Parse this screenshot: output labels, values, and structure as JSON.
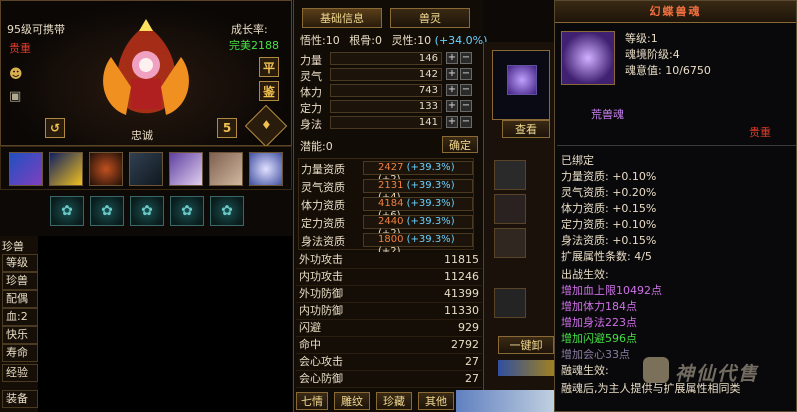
{
  "pet": {
    "level_text": "95级可携带",
    "rarity": "贵重",
    "growth_label": "成长率:",
    "growth_value": "完美2188",
    "name": "忠诚",
    "btn_flat": "平",
    "btn_appraise": "鉴",
    "btn_5": "5"
  },
  "collection": {
    "header": "珍兽",
    "rows": [
      "等级",
      "珍兽",
      "配偶",
      "血:2",
      "快乐",
      "寿命",
      "经验",
      "装备"
    ]
  },
  "tabs": {
    "basic": "基础信息",
    "spirit": "兽灵"
  },
  "stats": {
    "wuxing_label": "悟性:",
    "wuxing_value": "10",
    "gengu_label": "根骨:",
    "gengu_value": "0",
    "lingxing_label": "灵性:",
    "lingxing_value": "10",
    "lingxing_bonus": "(+34.0%)",
    "attrs": [
      {
        "label": "力量",
        "value": "146"
      },
      {
        "label": "灵气",
        "value": "142"
      },
      {
        "label": "体力",
        "value": "743"
      },
      {
        "label": "定力",
        "value": "133"
      },
      {
        "label": "身法",
        "value": "141"
      }
    ],
    "potential_label": "潜能:",
    "potential_value": "0",
    "confirm": "确定",
    "aptitudes": [
      {
        "label": "力量资质",
        "value": "2427",
        "pct": "(+39.3%)",
        "plus": "(+2)"
      },
      {
        "label": "灵气资质",
        "value": "2131",
        "pct": "(+39.3%)",
        "plus": "(+4)"
      },
      {
        "label": "体力资质",
        "value": "4184",
        "pct": "(+39.3%)",
        "plus": "(+6)"
      },
      {
        "label": "定力资质",
        "value": "2440",
        "pct": "(+39.3%)",
        "plus": "(+2)"
      },
      {
        "label": "身法资质",
        "value": "1800",
        "pct": "(+39.3%)",
        "plus": "(+2)"
      }
    ],
    "combat": [
      {
        "label": "外功攻击",
        "value": "11815"
      },
      {
        "label": "内功攻击",
        "value": "11246"
      },
      {
        "label": "外功防御",
        "value": "41399"
      },
      {
        "label": "内功防御",
        "value": "11330"
      },
      {
        "label": "闪避",
        "value": "929"
      },
      {
        "label": "命中",
        "value": "2792"
      },
      {
        "label": "会心攻击",
        "value": "27"
      },
      {
        "label": "会心防御",
        "value": "27"
      }
    ]
  },
  "spirit_panel": {
    "view_btn": "查看",
    "unequip_btn": "一键卸"
  },
  "bottom_tabs": [
    "七情",
    "雕纹",
    "珍藏",
    "其他"
  ],
  "tooltip": {
    "title": "幻蝶兽魂",
    "level": "等级:1",
    "realm": "魂境阶级:4",
    "intent": "魂意值: 10/6750",
    "type": "荒兽魂",
    "rarity": "贵重",
    "bound": "已绑定",
    "attrs": [
      "力量资质: +0.10%",
      "灵气资质: +0.20%",
      "体力资质: +0.15%",
      "定力资质: +0.10%",
      "身法资质: +0.15%"
    ],
    "expand": "扩展属性条数: 4/5",
    "battle_label": "出战生效:",
    "effects": [
      {
        "text": "增加血上限10492点",
        "color": "#d070e8"
      },
      {
        "text": "增加体力184点",
        "color": "#d070e8"
      },
      {
        "text": "增加身法223点",
        "color": "#d070e8"
      },
      {
        "text": "增加闪避596点",
        "color": "#46e046"
      },
      {
        "text": "增加会心33点",
        "color": "#8a7ca0"
      }
    ],
    "fusion_label": "融魂生效:",
    "fusion_text": "融魂后,为主人提供与扩展属性相同类"
  },
  "watermark": "神仙代售"
}
